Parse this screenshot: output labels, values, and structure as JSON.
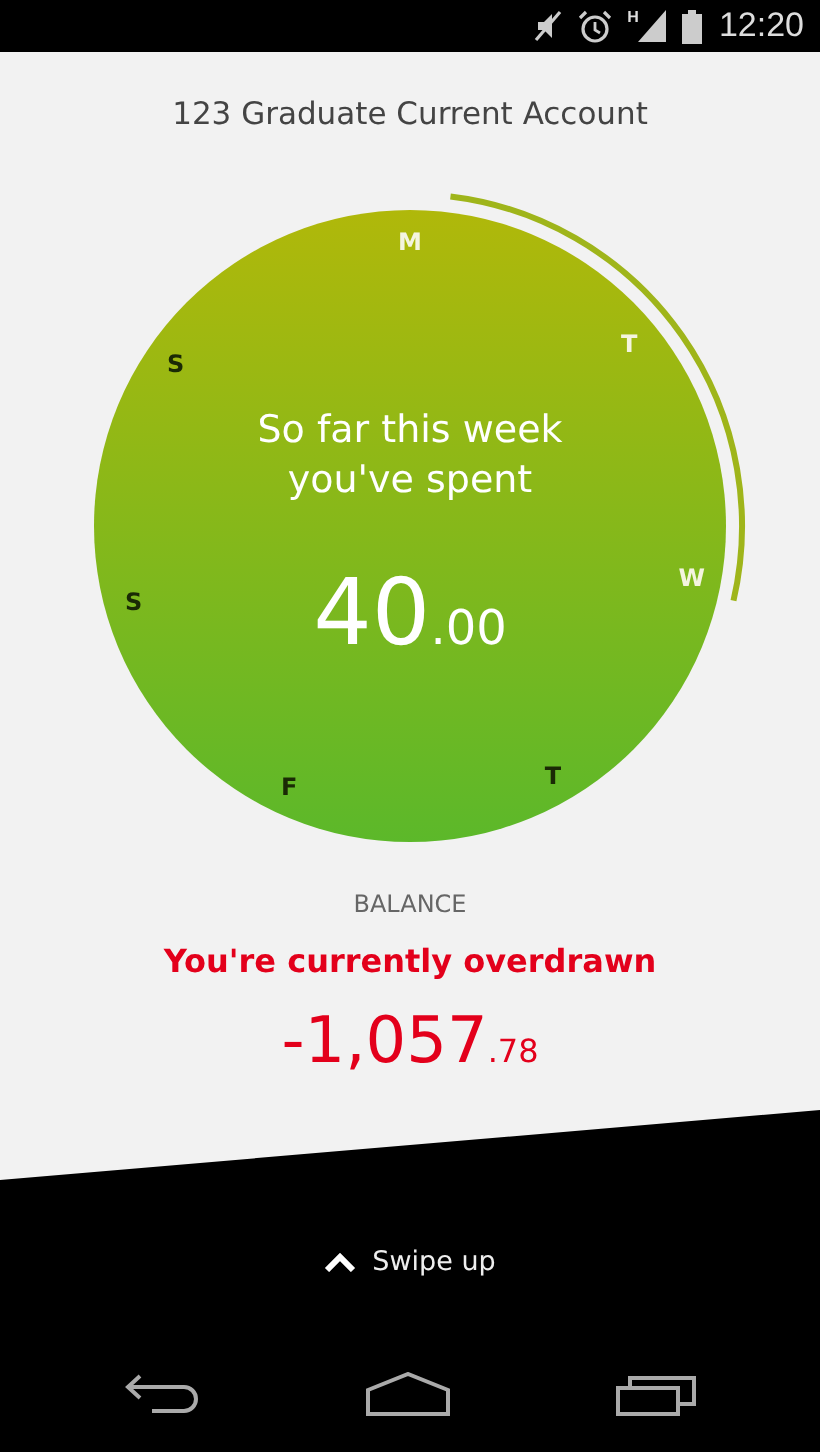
{
  "status_bar": {
    "time": "12:20",
    "network": "H"
  },
  "account": {
    "title": "123 Graduate Current Account"
  },
  "week_spend": {
    "caption": "So far this week you've spent",
    "amount_whole": "40",
    "amount_decimals": ".00",
    "days": [
      {
        "label": "M",
        "passed": true
      },
      {
        "label": "T",
        "passed": true
      },
      {
        "label": "W",
        "passed": true
      },
      {
        "label": "T",
        "passed": false
      },
      {
        "label": "F",
        "passed": false
      },
      {
        "label": "S",
        "passed": false
      },
      {
        "label": "S",
        "passed": false
      }
    ]
  },
  "balance": {
    "label": "BALANCE",
    "message": "You're currently overdrawn",
    "amount_whole": "-1,057",
    "amount_decimals": ".78"
  },
  "footer": {
    "hint": "Swipe up"
  }
}
